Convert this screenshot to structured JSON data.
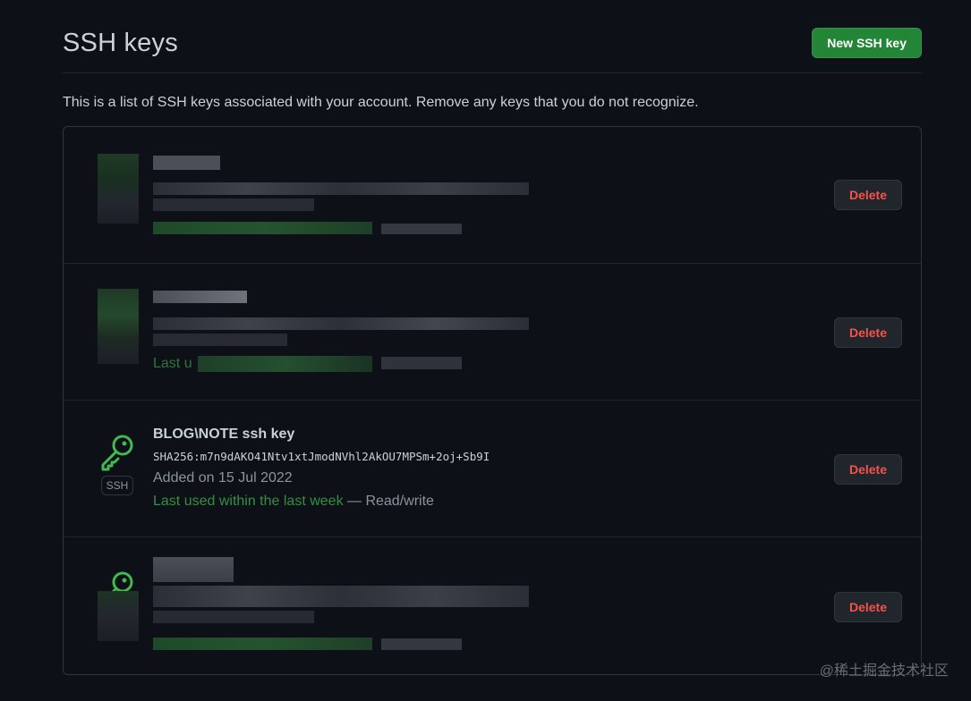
{
  "header": {
    "title": "SSH keys",
    "new_key_button": "New SSH key"
  },
  "intro_text": "This is a list of SSH keys associated with your account. Remove any keys that you do not recognize.",
  "keys": [
    {
      "redacted": true,
      "delete_label": "Delete"
    },
    {
      "redacted": true,
      "partial_text": "Last u",
      "delete_label": "Delete"
    },
    {
      "redacted": false,
      "title": "BLOG\\NOTE ssh key",
      "fingerprint": "SHA256:m7n9dAKO41Ntv1xtJmodNVhl2AkOU7MPSm+2oj+Sb9I",
      "added": "Added on 15 Jul 2022",
      "last_used": "Last used within the last week",
      "access": " — Read/write",
      "badge": "SSH",
      "icon": "key-icon",
      "delete_label": "Delete"
    },
    {
      "redacted": true,
      "delete_label": "Delete"
    }
  ],
  "watermark": "@稀土掘金技术社区",
  "colors": {
    "background": "#0d1117",
    "primary_button": "#238636",
    "danger_text": "#f85149",
    "success_text": "#3fb950",
    "border": "#30363d"
  }
}
